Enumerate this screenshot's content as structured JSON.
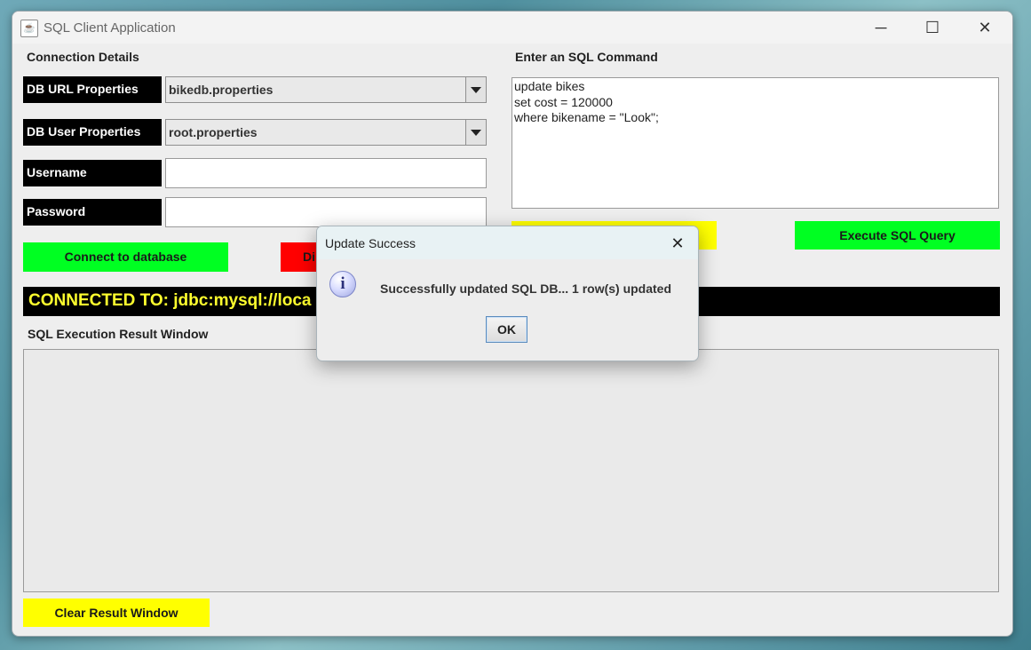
{
  "window": {
    "title": "SQL Client Application",
    "controls": {
      "minimize": "─",
      "maximize": "☐",
      "close": "✕"
    }
  },
  "connection": {
    "heading": "Connection Details",
    "db_url_label": "DB URL Properties",
    "db_url_value": "bikedb.properties",
    "db_user_label": "DB User Properties",
    "db_user_value": "root.properties",
    "username_label": "Username",
    "username_value": "",
    "password_label": "Password",
    "password_value": "",
    "connect_button": "Connect to database",
    "disconnect_button": "Di",
    "status_text": "CONNECTED TO: jdbc:mysql://loca"
  },
  "sql": {
    "heading": "Enter an SQL Command",
    "command": "update bikes\nset cost = 120000\nwhere bikename = \"Look\";",
    "clear_command_button": "",
    "execute_button": "Execute SQL Query"
  },
  "result": {
    "heading": "SQL Execution Result Window",
    "clear_button": "Clear Result Window"
  },
  "dialog": {
    "title": "Update Success",
    "close": "✕",
    "icon_glyph": "i",
    "message": "Successfully updated SQL DB... 1 row(s) updated",
    "ok_button": "OK"
  },
  "colors": {
    "green": "#00ff22",
    "red": "#ff0000",
    "yellow": "#ffff00",
    "status_bg": "#000000",
    "status_text": "#ffff2e"
  }
}
